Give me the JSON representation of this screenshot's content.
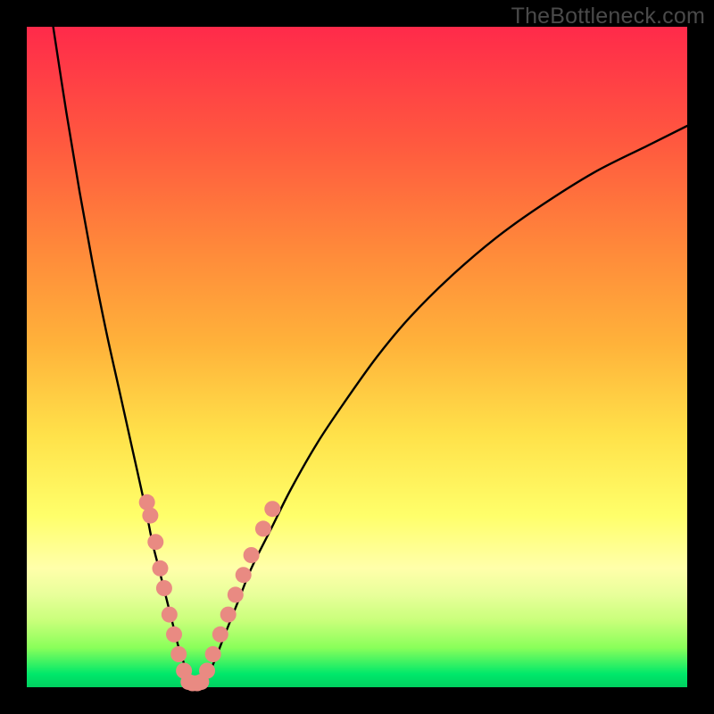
{
  "watermark": "TheBottleneck.com",
  "colors": {
    "curve": "#000000",
    "marker_fill": "#e98a82",
    "marker_stroke": "#d97a72"
  },
  "chart_data": {
    "type": "line",
    "title": "",
    "xlabel": "",
    "ylabel": "",
    "xlim": [
      0,
      100
    ],
    "ylim": [
      0,
      100
    ],
    "series": [
      {
        "name": "left-branch",
        "x": [
          4,
          6,
          8,
          10,
          12,
          14,
          16,
          18,
          19,
          20,
          21,
          22,
          23,
          24,
          24.7
        ],
        "y": [
          100,
          87,
          75,
          64,
          54,
          45,
          36,
          27,
          22,
          18,
          14,
          10,
          6,
          3,
          0.5
        ]
      },
      {
        "name": "right-branch",
        "x": [
          26.5,
          28,
          30,
          32,
          34,
          37,
          40,
          44,
          48,
          53,
          58,
          64,
          71,
          78,
          86,
          94,
          100
        ],
        "y": [
          0.5,
          3,
          8,
          13,
          18,
          24,
          30,
          37,
          43,
          50,
          56,
          62,
          68,
          73,
          78,
          82,
          85
        ]
      }
    ],
    "markers_left": [
      {
        "x": 18.2,
        "y": 28
      },
      {
        "x": 18.7,
        "y": 26
      },
      {
        "x": 19.5,
        "y": 22
      },
      {
        "x": 20.2,
        "y": 18
      },
      {
        "x": 20.8,
        "y": 15
      },
      {
        "x": 21.6,
        "y": 11
      },
      {
        "x": 22.3,
        "y": 8
      },
      {
        "x": 23.0,
        "y": 5
      },
      {
        "x": 23.8,
        "y": 2.5
      }
    ],
    "markers_bottom": [
      {
        "x": 24.5,
        "y": 0.8
      },
      {
        "x": 25.1,
        "y": 0.6
      },
      {
        "x": 25.8,
        "y": 0.6
      },
      {
        "x": 26.4,
        "y": 0.8
      }
    ],
    "markers_right": [
      {
        "x": 27.3,
        "y": 2.5
      },
      {
        "x": 28.2,
        "y": 5
      },
      {
        "x": 29.3,
        "y": 8
      },
      {
        "x": 30.5,
        "y": 11
      },
      {
        "x": 31.6,
        "y": 14
      },
      {
        "x": 32.8,
        "y": 17
      },
      {
        "x": 34.0,
        "y": 20
      },
      {
        "x": 35.8,
        "y": 24
      },
      {
        "x": 37.2,
        "y": 27
      }
    ]
  }
}
